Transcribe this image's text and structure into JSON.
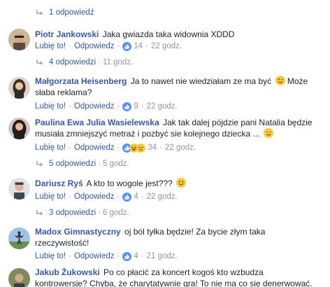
{
  "thread": {
    "top_reply_toggle": {
      "count_label": "1 odpowiedź"
    },
    "comments": [
      {
        "author": "Piotr Jankowski",
        "text": "Jaka gwiazda taka widownia XDDD",
        "like_label": "Lubię to!",
        "reply_label": "Odpowiedz",
        "reaction_count": "14",
        "time": "22 godz.",
        "reactions": [
          "like"
        ],
        "replies": {
          "count_label": "4 odpowiedzi",
          "time": "11 godz."
        }
      },
      {
        "author": "Małgorzata Heisenberg",
        "text_line1": "Ja to nawet nie wiedziałam ze ma być",
        "text_line1_tail": "Może",
        "text_line2": "słaba reklama?",
        "emoji": "tongue-wink-emoji",
        "like_label": "Lubię to!",
        "reply_label": "Odpowiedz",
        "reaction_count": "9",
        "time": "22 godz.",
        "reactions": [
          "like"
        ]
      },
      {
        "author": "Paulina Ewa Julia Wasielewska",
        "text_line1": "Jak tak dalej pójdzie pani Natalia będzie",
        "text_line2": "musiała zmniejszyć metraż i pozbyć sie kolejnego dziecka ...",
        "emoji": "disappointed-emoji",
        "like_label": "Lubię to!",
        "reply_label": "Odpowiedz",
        "reaction_count": "34",
        "time": "22 godz.",
        "reactions": [
          "like",
          "haha",
          "sad"
        ],
        "replies": {
          "count_label": "5 odpowiedzi",
          "time": "5 godz."
        }
      },
      {
        "author": "Dariusz Ryś",
        "text": "A kto to wogole jest???",
        "emoji": "smile-emoji",
        "like_label": "Lubię to!",
        "reply_label": "Odpowiedz",
        "reaction_count": "4",
        "time": "22 godz.",
        "reactions": [
          "like"
        ],
        "replies": {
          "count_label": "3 odpowiedzi",
          "time": "6 godz."
        }
      },
      {
        "author": "Madox Gimnastyczny",
        "text_line1": "oj ból tyłka będzie! Za bycie złym taka",
        "text_line2": "rzeczywistość!",
        "like_label": "Lubię to!",
        "reply_label": "Odpowiedz",
        "reaction_count": "4",
        "time": "21 godz.",
        "reactions": [
          "like"
        ]
      },
      {
        "author": "Jakub Żukowski",
        "text_line1": "Po co płacić za koncert kogoś kto wzbudza",
        "text_line2": "kontrowersje? Chyba, że charytatywnie gra! To nie ma co się denerwować."
      }
    ]
  },
  "colors": {
    "link": "#385898",
    "meta": "#90949c",
    "text": "#1d2129",
    "like_blue": "#5890ff",
    "emoji_yellow": "#f7c93f"
  },
  "separator": "·"
}
